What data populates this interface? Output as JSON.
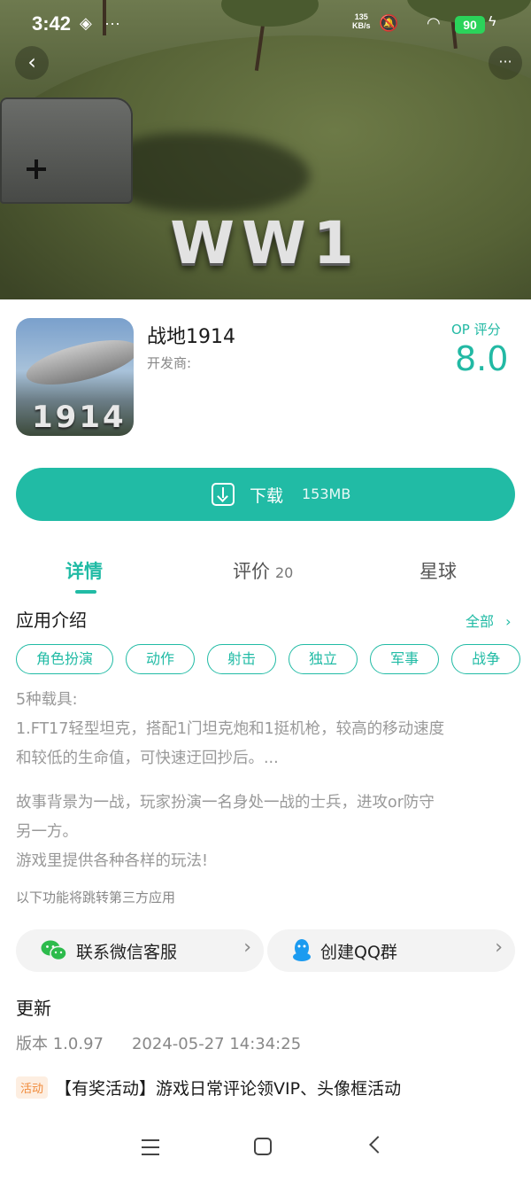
{
  "status_bar": {
    "time": "3:42",
    "net_speed": "135",
    "net_unit": "KB/s",
    "battery": "90"
  },
  "hero": {
    "banner_text": "WW1"
  },
  "nav": {
    "back_icon": "chevron-left-icon",
    "more_label": "···"
  },
  "app": {
    "icon_text": "1914",
    "name": "战地1914",
    "developer_label": "开发商:",
    "rating_label": "OP 评分",
    "rating_value": "8.0"
  },
  "download": {
    "label": "下载",
    "size": "153MB",
    "color": "#21bba5"
  },
  "tabs": [
    {
      "label": "详情",
      "count": ""
    },
    {
      "label": "评价",
      "count": "20"
    },
    {
      "label": "星球",
      "count": ""
    }
  ],
  "intro": {
    "title": "应用介绍",
    "all_label": "全部",
    "tags": [
      "角色扮演",
      "动作",
      "射击",
      "独立",
      "军事",
      "战争"
    ],
    "desc_lines": [
      "5种载具:",
      "1.FT17轻型坦克，搭配1门坦克炮和1挺机枪，较高的移动速度",
      "和较低的生命值，可快速迂回抄后。..."
    ],
    "desc2_lines": [
      "故事背景为一战，玩家扮演一名身处一战的士兵，进攻or防守",
      "另一方。",
      "游戏里提供各种各样的玩法!"
    ],
    "third_party_note": "以下功能将跳转第三方应用"
  },
  "services": {
    "wechat_label": "联系微信客服",
    "qq_label": "创建QQ群"
  },
  "update": {
    "title": "更新",
    "version": "版本 1.0.97",
    "date": "2024-05-27 14:34:25"
  },
  "event": {
    "badge": "活动",
    "text": "【有奖活动】游戏日常评论领VIP、头像框活动"
  }
}
